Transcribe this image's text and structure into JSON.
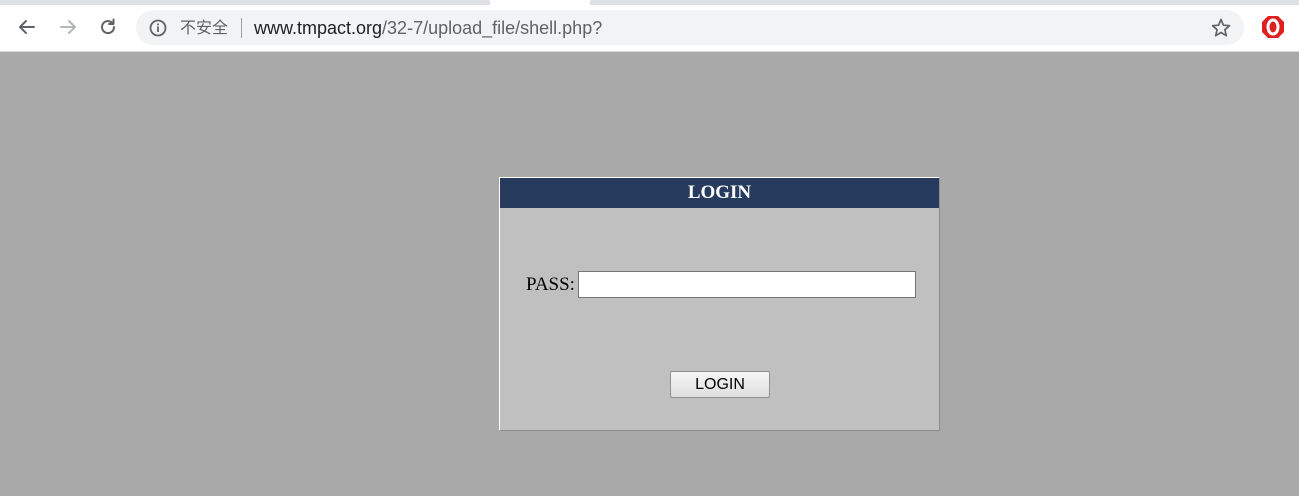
{
  "browser": {
    "security_label": "不安全",
    "url_host": "www.tmpact.org",
    "url_path": "/32-7/upload_file/shell.php?",
    "icons": [
      "back-icon",
      "forward-icon",
      "reload-icon",
      "info-icon",
      "star-icon",
      "extension-icon"
    ]
  },
  "login": {
    "header": "LOGIN",
    "pass_label": "PASS:",
    "pass_value": "",
    "button_label": "LOGIN"
  },
  "colors": {
    "page_background": "#a9a9a9",
    "panel_background": "#c0c0c0",
    "header_background": "#263b5e"
  }
}
